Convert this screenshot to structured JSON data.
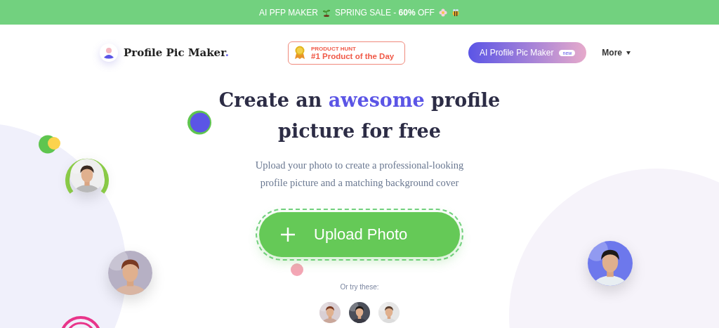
{
  "banner": {
    "brand": "AI PFP MAKER",
    "sale": "SPRING SALE - **60%** OFF"
  },
  "header": {
    "logo": "Profile Pic Maker",
    "logo_dot": ".",
    "badge": {
      "eyebrow": "PRODUCT HUNT",
      "title": "#1 Product of the Day"
    },
    "cta": {
      "label": "AI Profile Pic Maker",
      "tag": "new"
    },
    "more": "More"
  },
  "hero": {
    "title_before": "Create an",
    "title_accent": "awesome",
    "title_after": "profile picture for free",
    "subtitle": "Upload your photo to create a professional-looking profile picture and a matching background cover",
    "upload": "Upload Photo",
    "try_label": "Or try these:"
  }
}
